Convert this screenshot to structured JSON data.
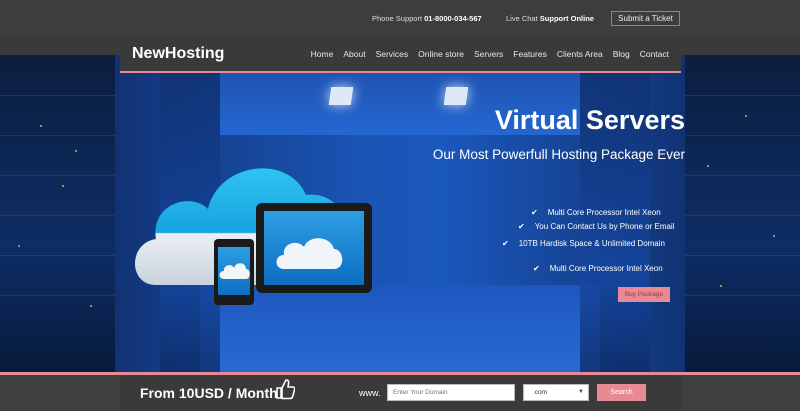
{
  "topbar": {
    "support_label": "Phone Support",
    "support_number": "01-8000-034-567",
    "chat_label": "Live Chat",
    "chat_status": "Support Online",
    "ticket_button": "Submit a Ticket"
  },
  "nav": {
    "logo": "NewHosting",
    "items": [
      "Home",
      "About",
      "Services",
      "Online store",
      "Servers",
      "Features",
      "Clients Area",
      "Blog",
      "Contact"
    ]
  },
  "hero": {
    "title": "Virtual Servers",
    "subtitle": "Our Most Powerfull Hosting Package Ever",
    "features": [
      "Multi Core Processor Intel Xeon",
      "You Can Contact Us by Phone or Email",
      "10TB Hardisk Space & Unlimited Domain",
      "Multi Core Processor Intel Xeon"
    ],
    "buy_button": "Buy Package"
  },
  "domain_bar": {
    "price": "From 10USD / Month",
    "www": "www.",
    "input_placeholder": "Enter Your Domain",
    "tld_selected": ".com",
    "search_button": "Search"
  },
  "colors": {
    "accent": "#e88a94",
    "bar": "#3a3a3a",
    "hero_blue": "#1a54b4"
  }
}
